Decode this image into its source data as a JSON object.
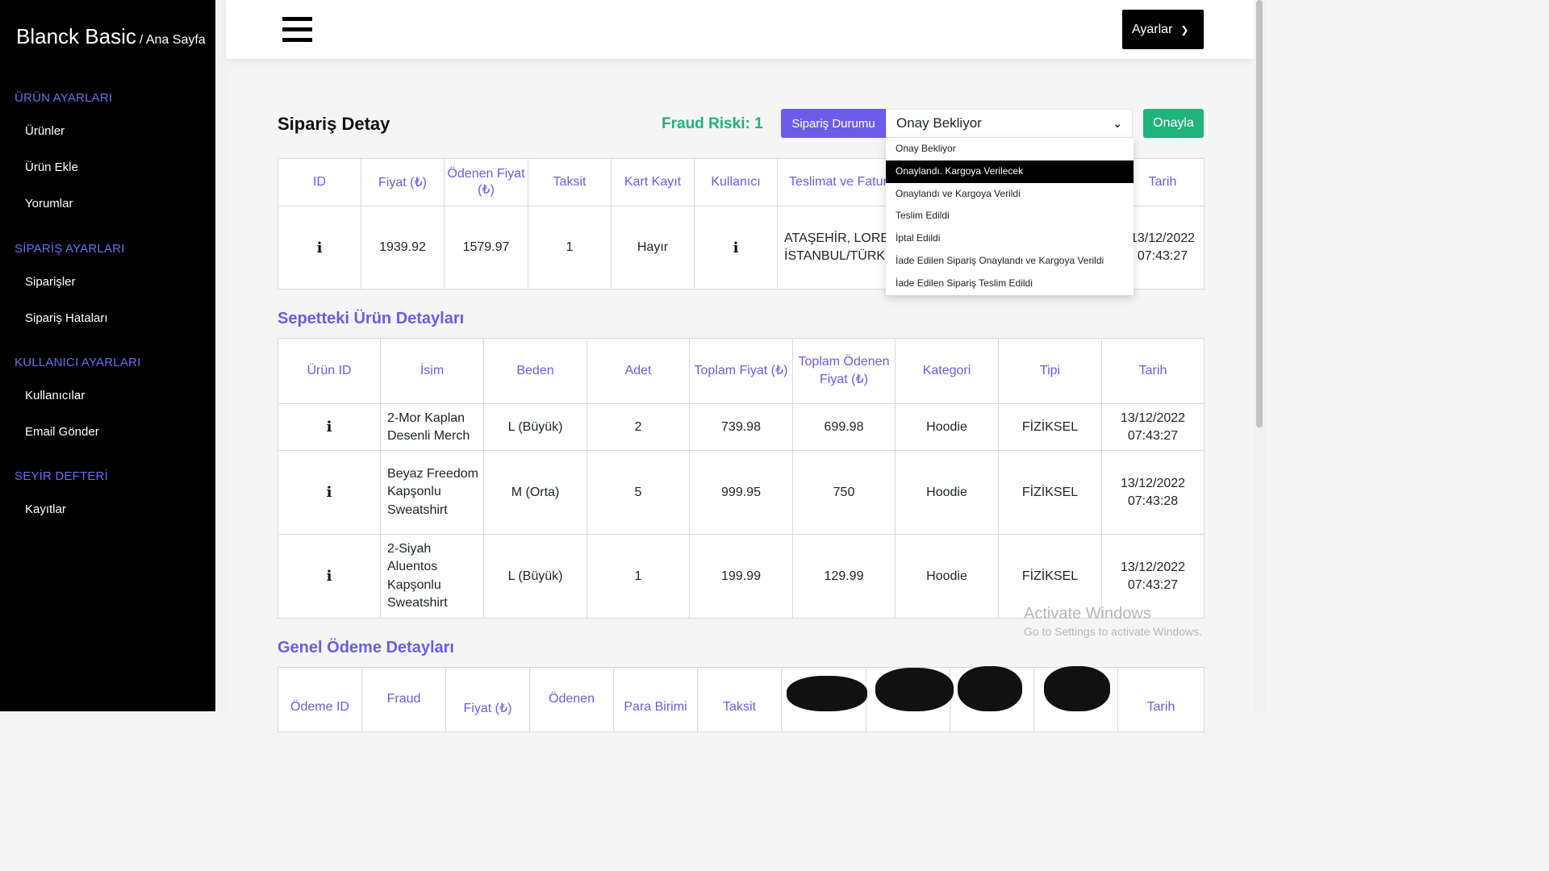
{
  "app": {
    "brand": "Blanck Basic",
    "breadcrumb": "/ Ana Sayfa"
  },
  "sidebar": {
    "sections": [
      {
        "title": "ÜRÜN AYARLARI",
        "items": [
          "Ürünler",
          "Ürün Ekle",
          "Yorumlar"
        ]
      },
      {
        "title": "SİPARİŞ AYARLARI",
        "items": [
          "Siparişler",
          "Sipariş Hataları"
        ]
      },
      {
        "title": "KULLANICI AYARLARI",
        "items": [
          "Kullanıcılar",
          "Email Gönder"
        ]
      },
      {
        "title": "SEYİR DEFTERİ",
        "items": [
          "Kayıtlar"
        ]
      }
    ]
  },
  "topbar": {
    "settings_label": "Ayarlar"
  },
  "order": {
    "title": "Sipariş Detay",
    "fraud": "Fraud Riski: 1",
    "status_button": "Sipariş Durumu",
    "status_selected": "Onay Bekliyor",
    "approve_label": "Onayla",
    "status_options": [
      "Onay Bekliyor",
      "Onaylandı. Kargoya Verilecek",
      "Onaylandı ve Kargoya Verildi",
      "Teslim Edildi",
      "İptal Edildi",
      "İade Edilen Sipariş Onaylandı ve Kargoya Verildi",
      "İade Edilen Sipariş Teslim Edildi"
    ],
    "highlighted_option": 1,
    "headers": [
      "ID",
      "Fiyat (₺)",
      "Ödenen Fiyat (₺)",
      "Taksit",
      "Kart Kayıt",
      "Kullanıcı",
      "Teslimat ve Fatura",
      "Tarih"
    ],
    "row": {
      "price": "1939.92",
      "paid": "1579.97",
      "installment": "1",
      "card_saved": "Hayır",
      "address": "ATAŞEHİR, LOREM IPSUM DOLOR SIT AMET İSTANBUL/TÜRKİYE Çakar",
      "date": "13/12/2022 07:43:27"
    }
  },
  "basket": {
    "title": "Sepetteki Ürün Detayları",
    "headers": [
      "Ürün ID",
      "İsim",
      "Beden",
      "Adet",
      "Toplam Fiyat (₺)",
      "Toplam Ödenen Fiyat (₺)",
      "Kategori",
      "Tipi",
      "Tarih"
    ],
    "rows": [
      {
        "name": "2-Mor Kaplan Desenli Merch",
        "size": "L (Büyük)",
        "qty": "2",
        "total": "739.98",
        "paid": "699.98",
        "category": "Hoodie",
        "type": "FİZİKSEL",
        "date": "13/12/2022 07:43:27"
      },
      {
        "name": "Beyaz Freedom Kapşonlu Sweatshirt",
        "size": "M (Orta)",
        "qty": "5",
        "total": "999.95",
        "paid": "750",
        "category": "Hoodie",
        "type": "FİZİKSEL",
        "date": "13/12/2022 07:43:28"
      },
      {
        "name": "2-Siyah Aluentos Kapşonlu Sweatshirt",
        "size": "L (Büyük)",
        "qty": "1",
        "total": "199.99",
        "paid": "129.99",
        "category": "Hoodie",
        "type": "FİZİKSEL",
        "date": "13/12/2022 07:43:27"
      }
    ]
  },
  "payment": {
    "title": "Genel Ödeme Detayları",
    "headers": [
      "Ödeme ID",
      "Fraud",
      "Fiyat (₺)",
      "Ödenen",
      "Para Birimi",
      "Taksit",
      "",
      "",
      "",
      "",
      "Tarih"
    ]
  },
  "watermark": {
    "line1": "Activate Windows",
    "line2": "Go to Settings to activate Windows."
  }
}
